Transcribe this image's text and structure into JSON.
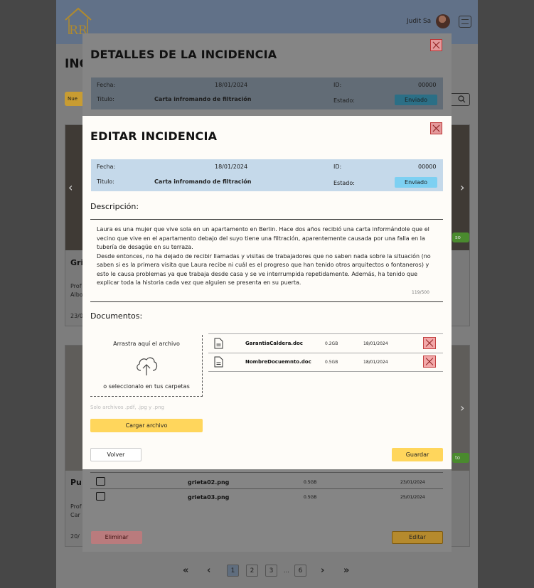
{
  "header": {
    "user_name": "Judit Sa"
  },
  "background": {
    "title": "INC",
    "new_button": "Nue"
  },
  "cards": [
    {
      "title": "Gri",
      "line1": "Prof",
      "line2": "Albo",
      "date": "23/0",
      "badge": "so"
    },
    {
      "title": "Pu",
      "line1": "Prof",
      "line2": "Car",
      "date": "20/",
      "badge": "to"
    }
  ],
  "modal_details": {
    "title": "DETALLES DE LA INCIDENCIA",
    "fecha_label": "Fecha:",
    "fecha_value": "18/01/2024",
    "id_label": "ID:",
    "id_value": "00000",
    "titulo_label": "Titulo:",
    "titulo_value": "Carta infromando de filtración",
    "estado_label": "Estado:",
    "estado_value": "Enviado",
    "attachments": [
      {
        "name": "grieta02.png",
        "size": "0.5GB",
        "date": "23/01/2024"
      },
      {
        "name": "grieta03.png",
        "size": "0.5GB",
        "date": "25/01/2024"
      }
    ],
    "delete_label": "Eliminar",
    "edit_label": "Editar"
  },
  "modal_edit": {
    "title": "EDITAR INCIDENCIA",
    "fecha_label": "Fecha:",
    "fecha_value": "18/01/2024",
    "id_label": "ID:",
    "id_value": "00000",
    "titulo_label": "Titulo:",
    "titulo_value": "Carta infromando de filtración",
    "estado_label": "Estado:",
    "estado_value": "Enviado",
    "description_label": "Descripción:",
    "description_p1": "Laura es una mujer que vive sola en un apartamento en Berlin. Hace dos años recibió una carta informándole que el vecino que vive en el apartamento debajo del suyo tiene una filtración, aparentemente causada por una falla en la tubería de desagüe en su terraza.",
    "description_p2": "Desde entonces, no ha dejado de recibir llamadas y visitas de trabajadores que no saben nada sobre la situación (no saben si es la primera visita que Laura recibe ni cuál es el progreso que han tenido otros arquitectos o fontaneros) y esto le causa problemas ya que trabaja desde casa y se ve interrumpida repetidamente. Además, ha tenido que explicar toda la historia cada vez que alguien se presenta en su puerta.",
    "char_counter": "119/500",
    "documents_label": "Documentos:",
    "drop_text_1": "Arrastra aquí el archivo",
    "drop_text_2": "o seleccionalo en tus carpetas",
    "file_hint": "Solo archivos .pdf, .jpg y .png",
    "upload_label": "Cargar archivo",
    "documents": [
      {
        "name": "GarantiaCaldera.doc",
        "size": "0.2GB",
        "date": "18/01/2024"
      },
      {
        "name": "NombreDocuemnto.doc",
        "size": "0.5GB",
        "date": "18/01/2024"
      }
    ],
    "back_label": "Volver",
    "save_label": "Guardar"
  },
  "pagination": {
    "pages": [
      "1",
      "2",
      "3",
      "6"
    ],
    "ellipsis": "...",
    "current": "1"
  }
}
